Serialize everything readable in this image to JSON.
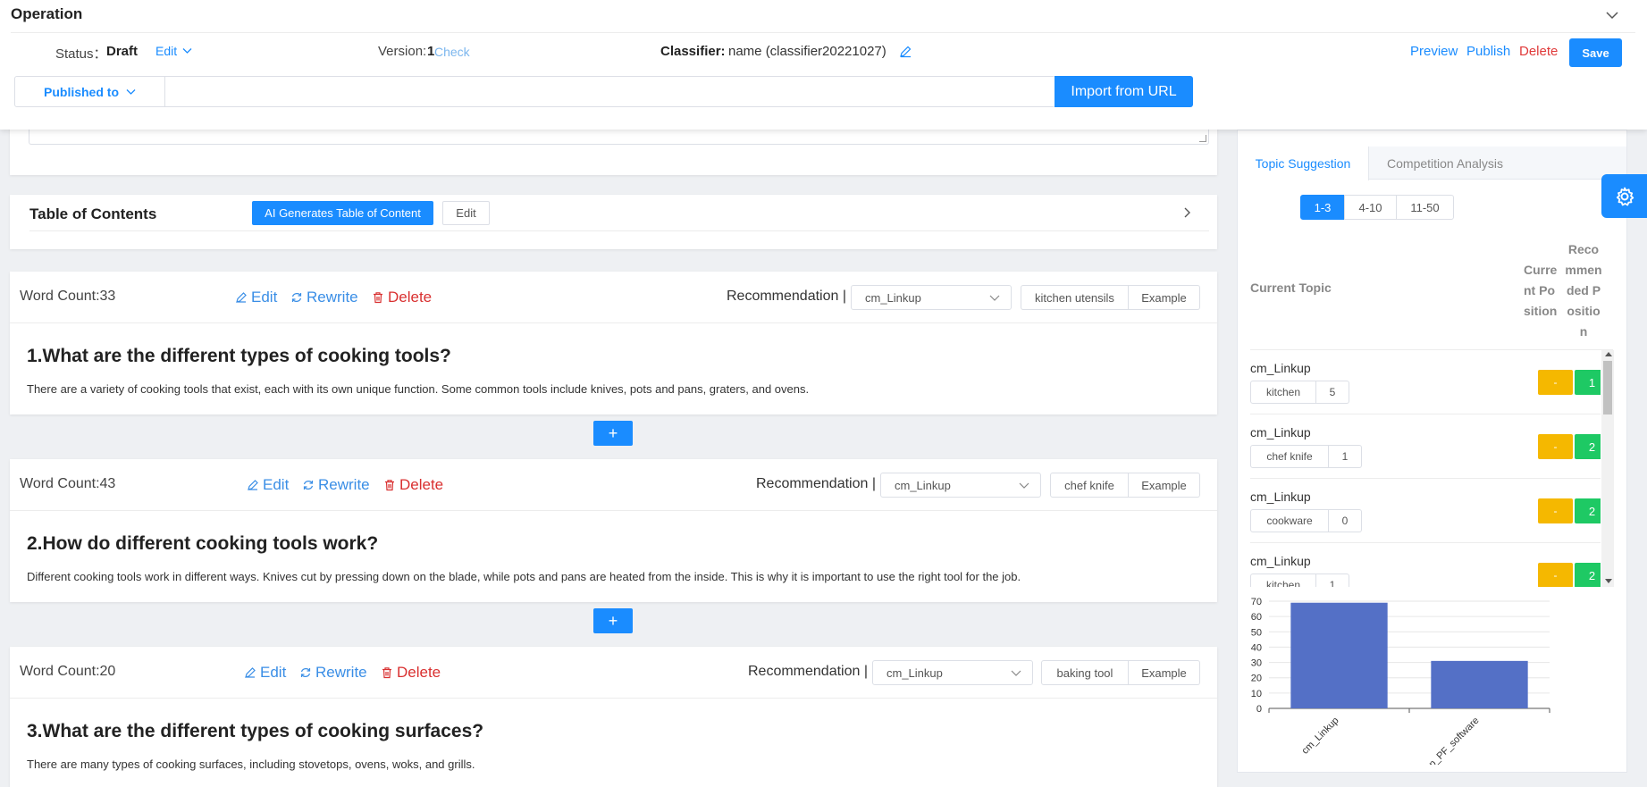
{
  "header": {
    "title": "Operation",
    "status_label": "Status：",
    "status_value": "Draft",
    "edit_label": "Edit",
    "version_label": "Version:",
    "version_value": "1",
    "check_label": "Check",
    "classifier_label": "Classifier:",
    "classifier_value": "name (classifier20221027)",
    "preview_label": "Preview",
    "publish_label": "Publish",
    "delete_label": "Delete",
    "save_label": "Save",
    "published_to_label": "Published to",
    "url_value": "",
    "import_label": "Import from URL"
  },
  "toc": {
    "title": "Table of Contents",
    "ai_button": "AI Generates Table of Content",
    "edit_button": "Edit"
  },
  "actions": {
    "edit": "Edit",
    "rewrite": "Rewrite",
    "delete": "Delete",
    "recommendation": "Recommendation |",
    "example": "Example",
    "add": "+"
  },
  "sections": [
    {
      "word_count": "Word Count:33",
      "recommendation_value": "cm_Linkup",
      "keyword": "kitchen utensils",
      "title": "1.What are the different types of cooking tools?",
      "body": "There are a variety of cooking tools that exist, each with its own unique function. Some common tools include knives, pots and pans, graters, and ovens."
    },
    {
      "word_count": "Word Count:43",
      "recommendation_value": "cm_Linkup",
      "keyword": "chef knife",
      "title": "2.How do different cooking tools work?",
      "body": "Different cooking tools work in different ways. Knives cut by pressing down on the blade, while pots and pans are heated from the inside. This is why it is important to use the right tool for the job."
    },
    {
      "word_count": "Word Count:20",
      "recommendation_value": "cm_Linkup",
      "keyword": "baking tool",
      "title": "3.What are the different types of cooking surfaces?",
      "body": "There are many types of cooking surfaces, including stovetops, ovens, woks, and grills."
    }
  ],
  "right_panel": {
    "tabs": [
      "Topic Suggestion",
      "Competition Analysis"
    ],
    "ranges": [
      "1-3",
      "4-10",
      "11-50"
    ],
    "col_topic": "Current Topic",
    "col_current": "Current Position",
    "col_recommended": "Recommended Position",
    "topics": [
      {
        "name": "cm_Linkup",
        "keyword": "kitchen",
        "count": "5",
        "current": "-",
        "recommended": "1"
      },
      {
        "name": "cm_Linkup",
        "keyword": "chef knife",
        "count": "1",
        "current": "-",
        "recommended": "2"
      },
      {
        "name": "cm_Linkup",
        "keyword": "cookware",
        "count": "0",
        "current": "-",
        "recommended": "2"
      },
      {
        "name": "cm_Linkup",
        "keyword": "kitchen",
        "count": "1",
        "current": "-",
        "recommended": "2"
      }
    ]
  },
  "colors": {
    "accent": "#1a8cff",
    "danger": "#d93030",
    "warning": "#f5b800",
    "success": "#1ec964",
    "bar": "#5470c6"
  },
  "icons": [
    "chevron-down-icon",
    "pen-icon",
    "rewrite-icon",
    "trash-icon",
    "chevron-right-icon",
    "gear-icon"
  ],
  "chart_data": {
    "type": "bar",
    "categories": [
      "cm_Linkup",
      "sp_PF_software"
    ],
    "values": [
      69,
      31
    ],
    "yticks": [
      "0",
      "10",
      "20",
      "30",
      "40",
      "50",
      "60",
      "70"
    ],
    "ylim": [
      0,
      70
    ],
    "grid": true,
    "xlabel": "",
    "ylabel": ""
  }
}
